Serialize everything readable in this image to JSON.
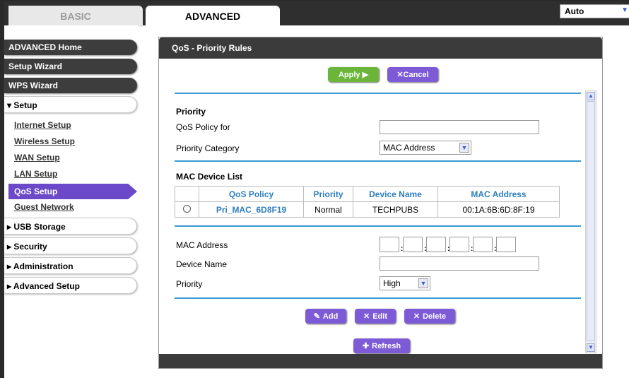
{
  "top": {
    "tab_basic": "BASIC",
    "tab_advanced": "ADVANCED",
    "language": "Auto"
  },
  "sidebar": {
    "advanced_home": "ADVANCED Home",
    "setup_wizard": "Setup Wizard",
    "wps_wizard": "WPS Wizard",
    "setup": "▾ Setup",
    "setup_items": [
      "Internet Setup",
      "Wireless Setup",
      "WAN Setup",
      "LAN Setup",
      "QoS Setup",
      "Guest Network"
    ],
    "usb_storage": "▸ USB Storage",
    "security": "▸ Security",
    "administration": "▸ Administration",
    "advanced_setup": "▸ Advanced Setup"
  },
  "panel": {
    "title": "QoS - Priority Rules",
    "apply": "Apply ▶",
    "cancel": "✕Cancel",
    "priority_heading": "Priority",
    "qos_policy_for_label": "QoS Policy for",
    "qos_policy_for_value": "",
    "priority_category_label": "Priority Category",
    "priority_category_value": "MAC Address",
    "mac_list_heading": "MAC Device List",
    "table": {
      "headers": [
        "",
        "QoS Policy",
        "Priority",
        "Device Name",
        "MAC Address"
      ],
      "rows": [
        {
          "policy": "Pri_MAC_6D8F19",
          "priority": "Normal",
          "device": "TECHPUBS",
          "mac": "00:1A:6B:6D:8F:19"
        }
      ]
    },
    "mac_address_label": "MAC Address",
    "device_name_label": "Device Name",
    "priority_label": "Priority",
    "priority_value": "High",
    "add": "Add",
    "edit": "Edit",
    "delete": "Delete",
    "refresh": "Refresh"
  },
  "colors": {
    "accent_green": "#6bb63a",
    "accent_purple": "#7d5ad6",
    "header_dark": "#3b3b3b",
    "divider_blue": "#3a9ad3"
  }
}
